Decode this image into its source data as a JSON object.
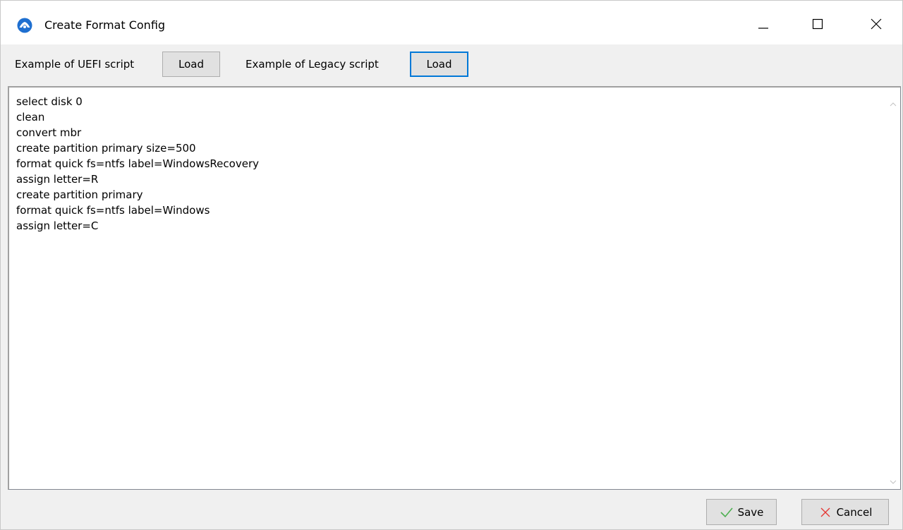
{
  "window": {
    "title": "Create Format Config",
    "app_icon": "app-logo-icon",
    "controls": [
      "minimize-icon",
      "maximize-icon",
      "close-icon"
    ]
  },
  "toolbar": {
    "uefi_label": "Example of UEFI script",
    "uefi_button": "Load",
    "legacy_label": "Example of Legacy script",
    "legacy_button": "Load"
  },
  "editor": {
    "text": "select disk 0\nclean\nconvert mbr\ncreate partition primary size=500\nformat quick fs=ntfs label=WindowsRecovery\nassign letter=R\ncreate partition primary\nformat quick fs=ntfs label=Windows\nassign letter=C"
  },
  "footer": {
    "save_label": "Save",
    "save_icon": "checkmark-icon",
    "cancel_label": "Cancel",
    "cancel_icon": "x-icon"
  },
  "colors": {
    "focus_border": "#0078d7",
    "save_icon": "#4caf50",
    "cancel_icon": "#e53935",
    "app_icon": "#1e6fd0"
  }
}
